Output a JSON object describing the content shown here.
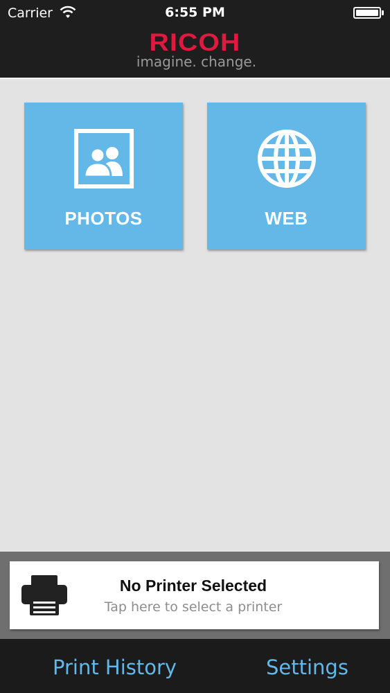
{
  "status_bar": {
    "carrier": "Carrier",
    "time": "6:55 PM",
    "wifi_icon": "wifi-icon",
    "battery_icon": "battery-icon"
  },
  "header": {
    "logo_text": "RICOH",
    "tagline": "imagine. change.",
    "logo_color": "#e0193f"
  },
  "tiles": [
    {
      "label": "PHOTOS",
      "icon": "photos-icon"
    },
    {
      "label": "WEB",
      "icon": "globe-icon"
    }
  ],
  "printer": {
    "title": "No Printer Selected",
    "subtitle": "Tap here to select a printer",
    "icon": "printer-icon"
  },
  "tab_bar": {
    "history_label": "Print History",
    "settings_label": "Settings"
  },
  "colors": {
    "tile": "#63b8e8",
    "header": "#1e1e1e",
    "background": "#e3e3e4",
    "accent": "#63b8e8"
  }
}
